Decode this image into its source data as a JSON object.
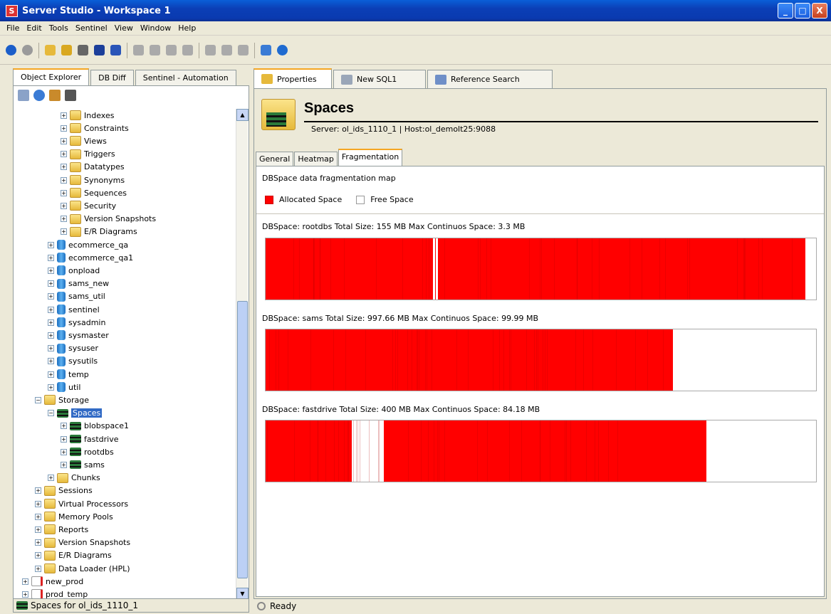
{
  "window": {
    "title": "Server Studio - Workspace 1",
    "icon_letter": "S",
    "btn_min": "_",
    "btn_max": "□",
    "btn_close": "X"
  },
  "menu": [
    "File",
    "Edit",
    "Tools",
    "Sentinel",
    "View",
    "Window",
    "Help"
  ],
  "toolbar_icons": [
    "back-icon",
    "forward-icon",
    "open-folder-icon",
    "up-folder-icon",
    "print-icon",
    "save-icon",
    "save-all-icon",
    "undo-icon",
    "copy-icon",
    "paste-icon",
    "cut-icon",
    "connect-icon",
    "disconnect-icon",
    "wizard-icon",
    "refresh-icon",
    "sentinel-icon"
  ],
  "left": {
    "tabs": [
      "Object Explorer",
      "DB Diff",
      "Sentinel - Automation"
    ],
    "tree": [
      {
        "label": "Indexes",
        "depth": 4,
        "icon": "indexes-icon"
      },
      {
        "label": "Constraints",
        "depth": 4,
        "icon": "constraints-icon"
      },
      {
        "label": "Views",
        "depth": 4,
        "icon": "views-icon"
      },
      {
        "label": "Triggers",
        "depth": 4,
        "icon": "triggers-icon"
      },
      {
        "label": "Datatypes",
        "depth": 4,
        "icon": "datatypes-icon"
      },
      {
        "label": "Synonyms",
        "depth": 4,
        "icon": "synonyms-icon"
      },
      {
        "label": "Sequences",
        "depth": 4,
        "icon": "sequences-icon"
      },
      {
        "label": "Security",
        "depth": 4,
        "icon": "security-icon"
      },
      {
        "label": "Version Snapshots",
        "depth": 4,
        "icon": "version-snapshots-icon"
      },
      {
        "label": "E/R Diagrams",
        "depth": 4,
        "icon": "er-diagrams-icon"
      },
      {
        "label": "ecommerce_qa",
        "depth": 3,
        "icon": "database-icon"
      },
      {
        "label": "ecommerce_qa1",
        "depth": 3,
        "icon": "database-icon"
      },
      {
        "label": "onpload",
        "depth": 3,
        "icon": "database-icon"
      },
      {
        "label": "sams_new",
        "depth": 3,
        "icon": "database-icon"
      },
      {
        "label": "sams_util",
        "depth": 3,
        "icon": "database-icon"
      },
      {
        "label": "sentinel",
        "depth": 3,
        "icon": "database-icon"
      },
      {
        "label": "sysadmin",
        "depth": 3,
        "icon": "database-icon"
      },
      {
        "label": "sysmaster",
        "depth": 3,
        "icon": "database-icon"
      },
      {
        "label": "sysuser",
        "depth": 3,
        "icon": "database-icon"
      },
      {
        "label": "sysutils",
        "depth": 3,
        "icon": "database-icon"
      },
      {
        "label": "temp",
        "depth": 3,
        "icon": "database-icon"
      },
      {
        "label": "util",
        "depth": 3,
        "icon": "database-icon"
      },
      {
        "label": "Storage",
        "depth": 2,
        "icon": "storage-icon",
        "expanded": true
      },
      {
        "label": "Spaces",
        "depth": 3,
        "icon": "spaces-icon",
        "expanded": true,
        "selected": true
      },
      {
        "label": "blobspace1",
        "depth": 4,
        "icon": "dbspace-icon"
      },
      {
        "label": "fastdrive",
        "depth": 4,
        "icon": "dbspace-icon"
      },
      {
        "label": "rootdbs",
        "depth": 4,
        "icon": "dbspace-icon"
      },
      {
        "label": "sams",
        "depth": 4,
        "icon": "dbspace-icon"
      },
      {
        "label": "Chunks",
        "depth": 3,
        "icon": "chunks-icon"
      },
      {
        "label": "Sessions",
        "depth": 2,
        "icon": "sessions-icon"
      },
      {
        "label": "Virtual Processors",
        "depth": 2,
        "icon": "virtual-processors-icon"
      },
      {
        "label": "Memory Pools",
        "depth": 2,
        "icon": "memory-pools-icon"
      },
      {
        "label": "Reports",
        "depth": 2,
        "icon": "reports-icon"
      },
      {
        "label": "Version Snapshots",
        "depth": 2,
        "icon": "version-snapshots-icon"
      },
      {
        "label": "E/R Diagrams",
        "depth": 2,
        "icon": "er-diagrams-icon"
      },
      {
        "label": "Data Loader (HPL)",
        "depth": 2,
        "icon": "data-loader-icon"
      },
      {
        "label": "new_prod",
        "depth": 1,
        "icon": "server-disconnected-icon"
      },
      {
        "label": "prod_temp",
        "depth": 1,
        "icon": "server-disconnected-icon"
      }
    ],
    "status": "Spaces for ol_ids_1110_1"
  },
  "right": {
    "tabs": [
      "Properties",
      "New SQL1",
      "Reference Search"
    ],
    "title": "Spaces",
    "subtitle": "Server: ol_ids_1110_1 | Host:ol_demolt25:9088",
    "subtabs": [
      "General",
      "Heatmap",
      "Fragmentation"
    ],
    "description": "DBSpace data fragmentation map",
    "legend": {
      "allocated": "Allocated Space",
      "free": "Free Space"
    },
    "colors": {
      "allocated": "#ff0000",
      "free": "#ffffff"
    },
    "dbspaces": [
      {
        "label": "DBSpace: rootdbs   Total Size: 155 MB   Max Continuos Space: 3.3 MB",
        "allocated_fraction": 0.98,
        "allocated_ranges": [
          [
            0.0,
            0.3035
          ],
          [
            0.3075,
            0.3085
          ],
          [
            0.3125,
            0.98
          ]
        ]
      },
      {
        "label": "DBSpace: sams   Total Size: 997.66 MB   Max Continuos Space: 99.99 MB",
        "allocated_fraction": 0.74,
        "allocated_ranges": [
          [
            0.0,
            0.74
          ]
        ]
      },
      {
        "label": "DBSpace: fastdrive   Total Size: 400 MB   Max Continuos Space: 84.18 MB",
        "allocated_fraction": 0.67,
        "allocated_ranges": [
          [
            0.0,
            0.156
          ],
          [
            0.215,
            0.801
          ]
        ]
      }
    ],
    "status": "Ready"
  }
}
